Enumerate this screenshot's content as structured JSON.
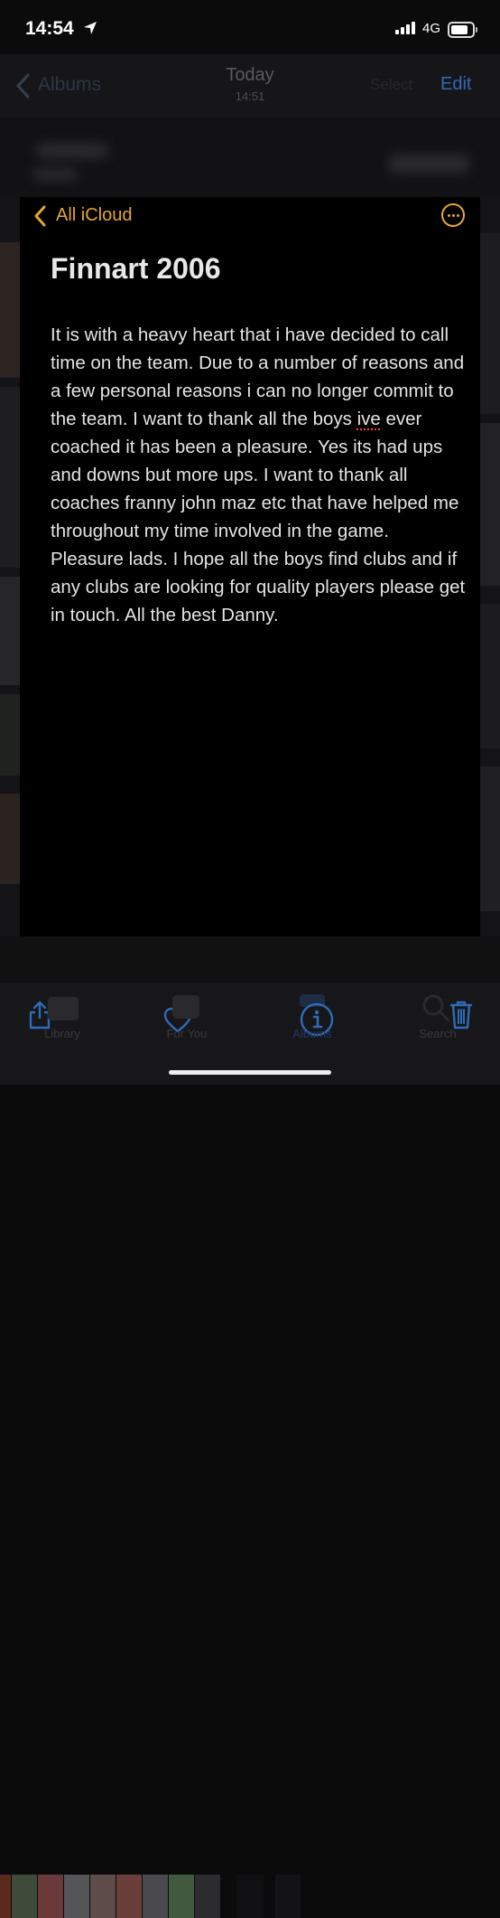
{
  "status_bar": {
    "time": "14:54",
    "network": "4G"
  },
  "photos_nav": {
    "back_label": "Albums",
    "title": "Today",
    "subtitle": "14:51",
    "select_label": "Select",
    "edit_label": "Edit"
  },
  "note": {
    "back_label": "All iCloud",
    "title": "Finnart 2006",
    "body_before": "It is with a heavy heart that i have decided to call time on the team. Due to a number of reasons and a few personal reasons i can no longer commit to the team. I want to thank all the boys ",
    "body_misspelled": "ive",
    "body_after": " ever coached it has been a pleasure. Yes its had ups and downs but more ups. I want to thank all coaches franny john maz etc that have helped me throughout my time involved in the game. Pleasure lads. I hope all the boys find clubs and if any clubs are looking for quality players please get in touch. All the best Danny."
  },
  "tabs": [
    {
      "label": "Library"
    },
    {
      "label": "For You"
    },
    {
      "label": "Albums"
    },
    {
      "label": "Search"
    }
  ],
  "colors": {
    "accent_orange": "#e7a630",
    "ios_blue": "#2e6bb8",
    "background": "#000000"
  }
}
